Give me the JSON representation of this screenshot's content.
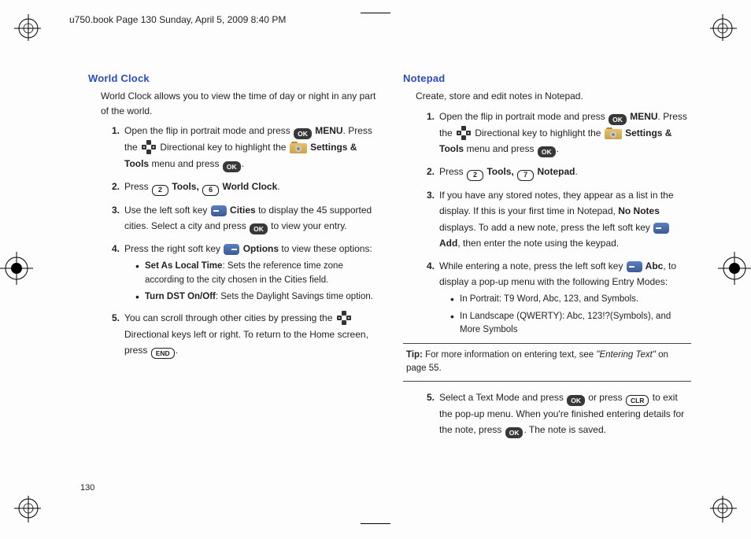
{
  "header": "u750.book  Page 130  Sunday, April 5, 2009  8:40 PM",
  "page_number": "130",
  "left": {
    "title": "World Clock",
    "intro": "World Clock allows you to view the time of day or night in any part of the world.",
    "s1a": "Open the flip in portrait mode and press ",
    "s1b": " MENU",
    "s1c": ". Press the ",
    "s1d": " Directional key to highlight the ",
    "s1e": " Settings & Tools",
    "s1f": " menu and press ",
    "s1g": ".",
    "s2a": "Press ",
    "s2b": " Tools, ",
    "s2c": " World Clock",
    "s2d": ".",
    "s3a": "Use the left soft key ",
    "s3b": " Cities",
    "s3c": " to display the 45 supported cities. Select a city and press ",
    "s3d": " to view your entry.",
    "s4a": "Press the right soft key ",
    "s4b": " Options",
    "s4c": " to view these options:",
    "b1a": "Set As Local Time",
    "b1b": ": Sets the reference time zone according to the city chosen in the Cities field.",
    "b2a": "Turn DST On/Off",
    "b2b": ": Sets the Daylight Savings time option.",
    "s5a": "You can scroll through other cities by pressing the ",
    "s5b": " Directional keys left or right. To return to the Home screen, press ",
    "s5c": ".",
    "key2": "2",
    "key6": "6",
    "endkey": "END",
    "okkey": "OK"
  },
  "right": {
    "title": "Notepad",
    "intro": "Create, store and edit notes in Notepad.",
    "s1a": "Open the flip in portrait mode and press ",
    "s1b": " MENU",
    "s1c": ". Press the ",
    "s1d": " Directional key to highlight the ",
    "s1e": " Settings & Tools",
    "s1f": " menu and press ",
    "s1g": ".",
    "s2a": "Press ",
    "s2b": " Tools, ",
    "s2c": " Notepad",
    "s2d": ".",
    "s3a": "If you have any stored notes, they appear as a list in the display. If this is your first time in Notepad, ",
    "s3b": "No Notes",
    "s3c": " displays. To add a new note, press the left soft key ",
    "s3d": " Add",
    "s3e": ", then enter the note using the keypad.",
    "s4a": "While entering a note, press the left soft key ",
    "s4b": " Abc",
    "s4c": ", to display a pop-up menu with the following Entry Modes:",
    "b1": "In Portrait: T9 Word, Abc, 123, and Symbols.",
    "b2": "In Landscape (QWERTY): Abc, 123!?(Symbols), and More Symbols",
    "tip_label": "Tip:",
    "tip_a": " For more information on entering text, see ",
    "tip_i": "\"Entering Text\"",
    "tip_b": " on page 55.",
    "s5a": "Select a Text Mode and press ",
    "s5b": " or press ",
    "s5c": " to exit the pop-up menu. When you're finished entering details for the note, press ",
    "s5d": ". The note is saved.",
    "key2": "2",
    "key7": "7",
    "clrkey": "CLR",
    "okkey": "OK"
  }
}
